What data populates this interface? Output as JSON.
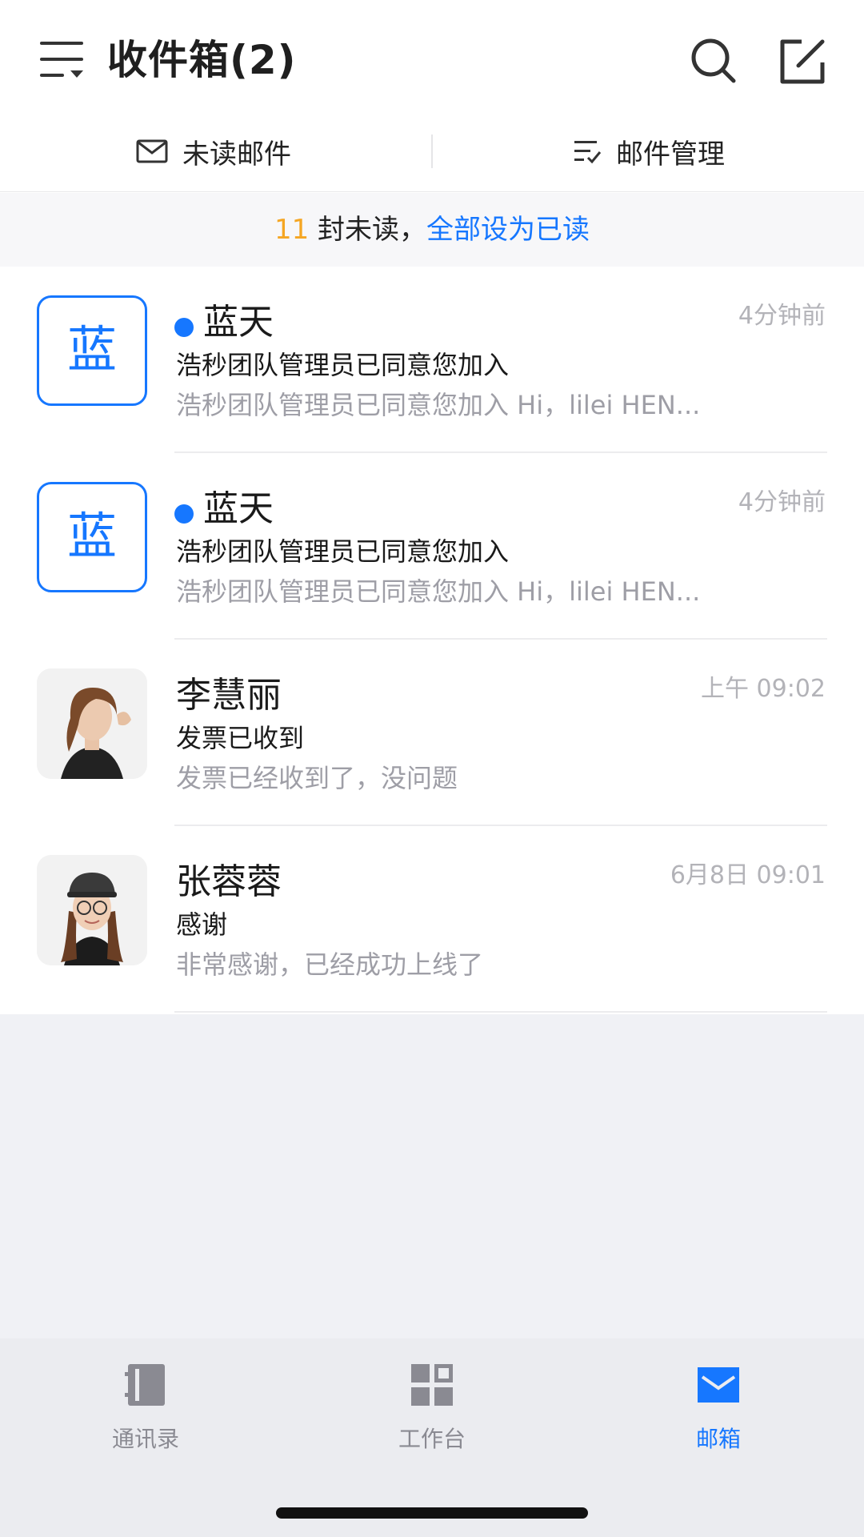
{
  "header": {
    "title": "收件箱(2)"
  },
  "toolbar": {
    "unread_label": "未读邮件",
    "manage_label": "邮件管理"
  },
  "notice": {
    "count": "11",
    "text": " 封未读，",
    "action": "全部设为已读"
  },
  "mails": [
    {
      "avatar_text": "蓝",
      "unread": true,
      "sender": "蓝天",
      "time": "4分钟前",
      "subject": "浩秒团队管理员已同意您加入",
      "preview": "浩秒团队管理员已同意您加入 Hi，lilei HEN..."
    },
    {
      "avatar_text": "蓝",
      "unread": true,
      "sender": "蓝天",
      "time": "4分钟前",
      "subject": "浩秒团队管理员已同意您加入",
      "preview": "浩秒团队管理员已同意您加入 Hi，lilei HEN..."
    },
    {
      "avatar_text": "",
      "unread": false,
      "sender": "李慧丽",
      "time": "上午 09:02",
      "subject": "发票已收到",
      "preview": "发票已经收到了，没问题"
    },
    {
      "avatar_text": "",
      "unread": false,
      "sender": "张蓉蓉",
      "time": "6月8日 09:01",
      "subject": "感谢",
      "preview": "非常感谢，已经成功上线了"
    }
  ],
  "tabbar": {
    "contacts": "通讯录",
    "workbench": "工作台",
    "mail": "邮箱",
    "active": "mail"
  },
  "colors": {
    "accent": "#1677ff",
    "count": "#f5a623"
  }
}
